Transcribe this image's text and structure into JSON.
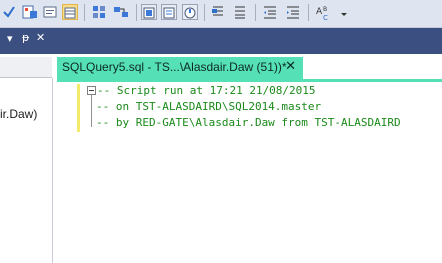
{
  "toolbar": {
    "icons": [
      "check-icon",
      "query-options-icon",
      "results-to-text-icon",
      "results-to-grid-icon",
      "results-to-file-icon",
      "display-plan-icon",
      "include-plan-icon",
      "statistics-icon",
      "client-stats-icon",
      "comment-icon",
      "uncomment-icon",
      "decrease-indent-icon",
      "increase-indent-icon",
      "specify-values-icon",
      "overflow-icon"
    ]
  },
  "left_panel": {
    "pin_glyph": "▾",
    "pin_icon": "ᵽ",
    "close_glyph": "✕",
    "visible_text": "ir.Daw)"
  },
  "document_tab": {
    "label": "SQLQuery5.sql - TS...\\Alasdair.Daw (51))*",
    "close_glyph": "✕",
    "accent_color": "#55e0b5"
  },
  "editor": {
    "lines": [
      "-- Script run at 17:21 21/08/2015",
      "-- on TST-ALASDAIRD\\SQL2014.master",
      "-- by RED-GATE\\Alasdair.Daw from TST-ALASDAIRD"
    ],
    "comment_color": "#1a8a1a"
  }
}
